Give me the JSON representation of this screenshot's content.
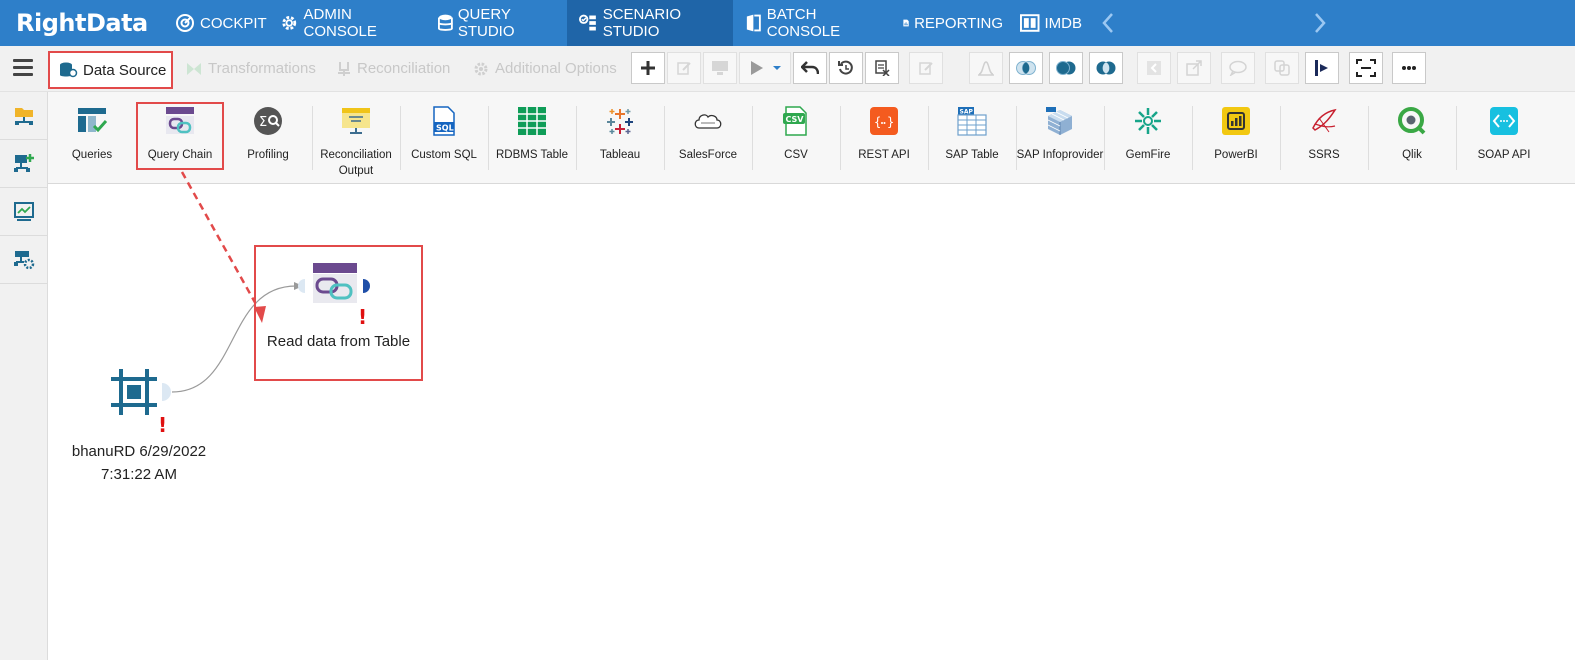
{
  "header": {
    "logo_text": "RightData",
    "tabs": [
      {
        "label": "COCKPIT",
        "icon": "cockpit-icon"
      },
      {
        "label": "ADMIN CONSOLE",
        "icon": "gear-icon"
      },
      {
        "label": "QUERY STUDIO",
        "icon": "database-icon"
      },
      {
        "label": "SCENARIO STUDIO",
        "icon": "scenario-icon",
        "active": true
      },
      {
        "label": "BATCH CONSOLE",
        "icon": "batch-icon"
      },
      {
        "label": "REPORTING",
        "icon": "report-icon"
      },
      {
        "label": "IMDB",
        "icon": "imdb-icon"
      }
    ]
  },
  "toolbar": {
    "tabs": [
      {
        "label": "Data Source",
        "active": true
      },
      {
        "label": "Transformations",
        "active": false
      },
      {
        "label": "Reconciliation",
        "active": false
      },
      {
        "label": "Additional Options",
        "active": false
      }
    ]
  },
  "ribbon": {
    "items": [
      {
        "label": "Queries",
        "icon": "queries-icon"
      },
      {
        "label": "Query Chain",
        "icon": "query-chain-icon",
        "highlighted": true
      },
      {
        "label": "Profiling",
        "icon": "profiling-icon"
      },
      {
        "label": "Reconciliation Output",
        "icon": "reconciliation-output-icon"
      },
      {
        "label": "Custom SQL",
        "icon": "sql-file-icon"
      },
      {
        "label": "RDBMS Table",
        "icon": "table-grid-icon"
      },
      {
        "label": "Tableau",
        "icon": "tableau-icon"
      },
      {
        "label": "SalesForce",
        "icon": "salesforce-icon"
      },
      {
        "label": "CSV",
        "icon": "csv-icon"
      },
      {
        "label": "REST API",
        "icon": "rest-api-icon"
      },
      {
        "label": "SAP Table",
        "icon": "sap-table-icon"
      },
      {
        "label": "SAP Infoprovider",
        "icon": "sap-cube-icon"
      },
      {
        "label": "GemFire",
        "icon": "gemfire-icon"
      },
      {
        "label": "PowerBI",
        "icon": "powerbi-icon"
      },
      {
        "label": "SSRS",
        "icon": "ssrs-icon"
      },
      {
        "label": "Qlik",
        "icon": "qlik-icon"
      },
      {
        "label": "SOAP API",
        "icon": "soap-api-icon"
      }
    ]
  },
  "canvas": {
    "source_node": {
      "label_line1": "bhanuRD 6/29/2022",
      "label_line2": "7:31:22 AM",
      "warning": "!"
    },
    "target_node": {
      "label": "Read data from Table",
      "warning": "!"
    }
  },
  "colors": {
    "nav_bg": "#2e7fc9",
    "nav_active": "#1f65a8",
    "highlight": "#e24a4a",
    "node_blue": "#1e6a8f"
  }
}
